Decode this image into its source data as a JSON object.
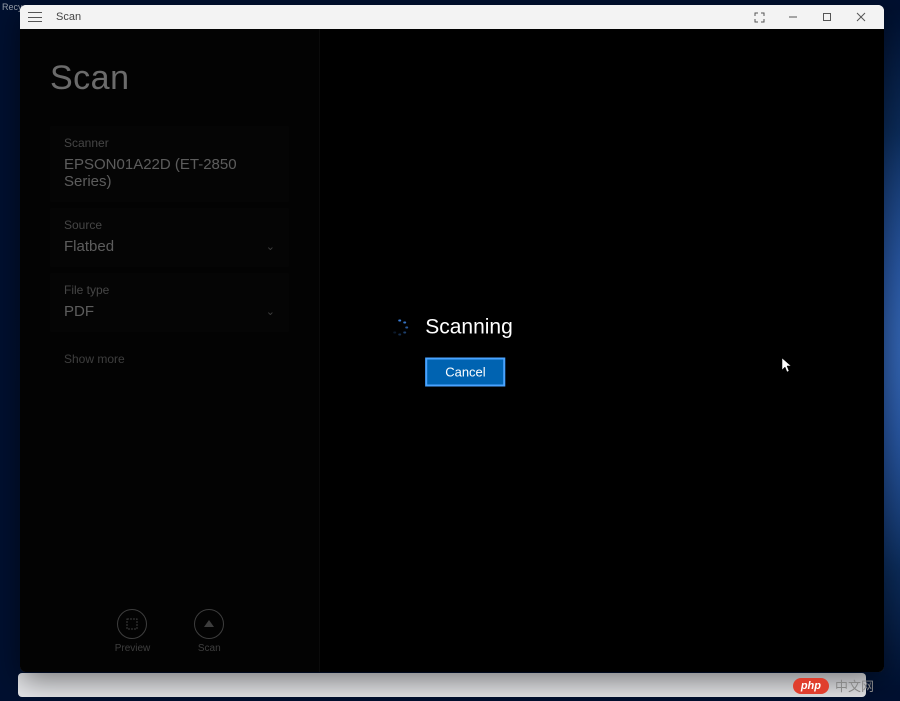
{
  "desktop": {
    "recycle_label": "Recy..."
  },
  "window": {
    "title": "Scan"
  },
  "sidebar": {
    "heading": "Scan",
    "scanner": {
      "label": "Scanner",
      "value": "EPSON01A22D (ET-2850 Series)"
    },
    "source": {
      "label": "Source",
      "value": "Flatbed"
    },
    "filetype": {
      "label": "File type",
      "value": "PDF"
    },
    "show_more": "Show more",
    "preview_label": "Preview",
    "scan_label": "Scan"
  },
  "dialog": {
    "status_text": "Scanning",
    "cancel_label": "Cancel"
  },
  "watermark": {
    "badge": "php",
    "text": "中文网"
  },
  "colors": {
    "accent": "#0063b1"
  }
}
